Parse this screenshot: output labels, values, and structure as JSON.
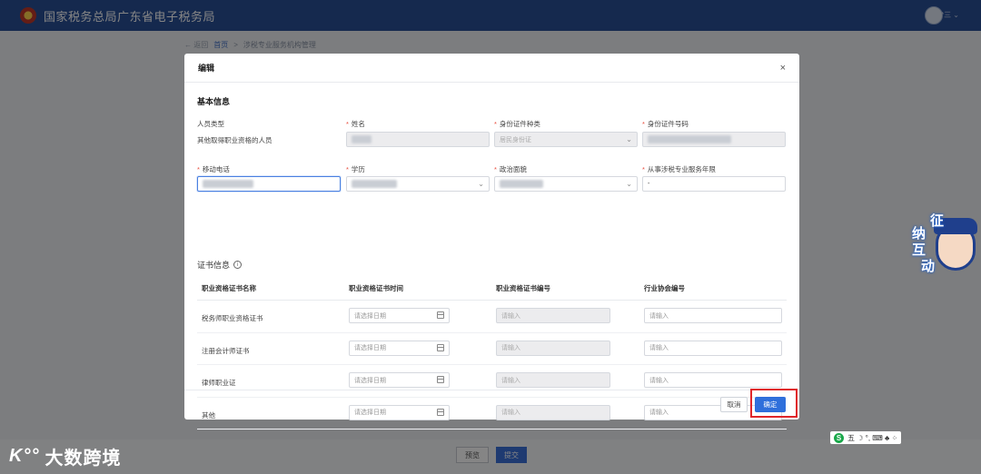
{
  "app": {
    "title": "国家税务总局广东省电子税务局",
    "user_label": "*三 ⌄"
  },
  "breadcrumb": {
    "back": "← 返回",
    "home": "首页",
    "separator": ">",
    "current": "涉税专业服务机构管理"
  },
  "page_buttons": {
    "preview": "预览",
    "submit": "提交"
  },
  "modal": {
    "title": "编辑",
    "close": "×",
    "section_basic": "基本信息",
    "fields": {
      "person_type_label": "人员类型",
      "person_type_value": "其他取得职业资格的人员",
      "name_label": "姓名",
      "id_type_label": "身份证件种类",
      "id_type_value": "居民身份证",
      "id_number_label": "身份证件号码",
      "mobile_label": "移动电话",
      "education_label": "学历",
      "political_label": "政治面貌",
      "years_label": "从事涉税专业服务年限",
      "years_value": "-"
    },
    "section_cert": "证书信息",
    "cert_table": {
      "headers": [
        "职业资格证书名称",
        "职业资格证书时间",
        "职业资格证书编号",
        "行业协会编号"
      ],
      "date_placeholder": "请选择日期",
      "input_placeholder": "请输入",
      "rows": [
        "税务师职业资格证书",
        "注册会计师证书",
        "律师职业证",
        "其他"
      ]
    },
    "cancel": "取消",
    "ok": "确定"
  },
  "widget": {
    "chars": [
      "征",
      "纳",
      "互",
      "动"
    ]
  },
  "ime": {
    "icon": "S",
    "text": "五 ☽ °, ⌨ ♣ ⁘"
  },
  "watermark": {
    "logo": "K°°",
    "text": "大数跨境"
  },
  "colors": {
    "topbar": "#2a4f96",
    "primary": "#2f6fdb",
    "highlight": "#e0262a",
    "required": "#e74c3c"
  }
}
